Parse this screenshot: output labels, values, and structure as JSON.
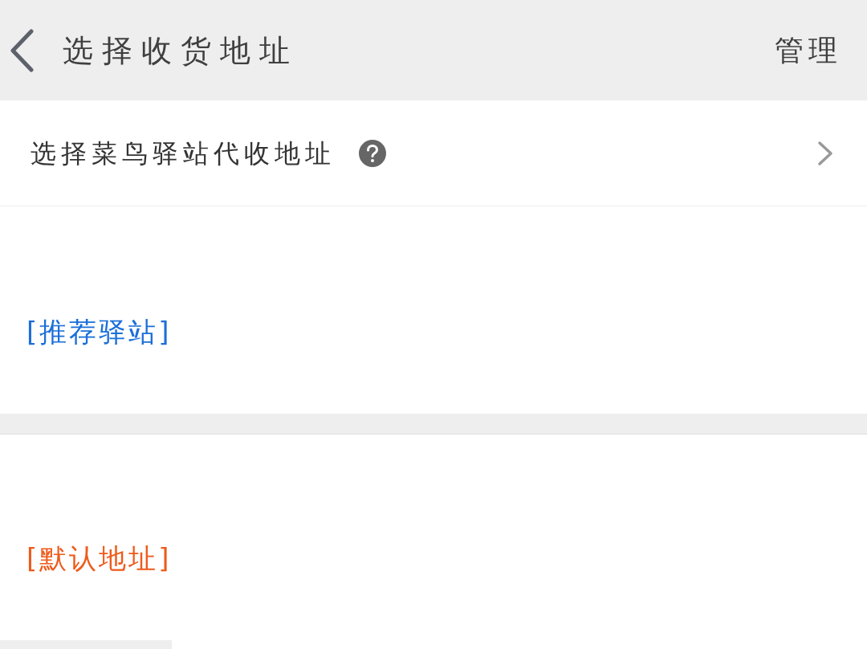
{
  "header": {
    "title": "选择收货地址",
    "action": "管理"
  },
  "station_row": {
    "label": "选择菜鸟驿站代收地址"
  },
  "sections": [
    {
      "label": "[推荐驿站]",
      "color": "#1b6fd9"
    },
    {
      "label": "[默认地址]",
      "color": "#ee5b1c"
    }
  ]
}
